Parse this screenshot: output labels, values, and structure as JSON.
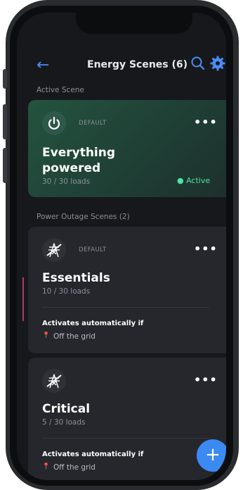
{
  "header": {
    "title": "Energy Scenes (6)",
    "back_icon": "arrow-left-icon",
    "search_icon": "search-icon",
    "settings_icon": "gear-icon"
  },
  "sections": {
    "active_label": "Active Scene",
    "outage_label": "Power Outage Scenes (2)"
  },
  "active_scene": {
    "tag": "DEFAULT",
    "name_line1": "Everything",
    "name_line2": "powered",
    "loads": "30 / 30 loads",
    "status": "● Active",
    "icon": "power-icon"
  },
  "outage_scenes": [
    {
      "tag": "DEFAULT",
      "name": "Essentials",
      "loads": "10 / 30 loads",
      "auto_label": "Activates automatically if",
      "condition": "Off the grid",
      "icon": "grid-off-icon"
    },
    {
      "tag": "",
      "name": "Critical",
      "loads": "5 / 30 loads",
      "auto_label": "Activates automatically if",
      "condition": "Off the grid",
      "icon": "grid-off-icon"
    }
  ],
  "colors": {
    "accent": "#3b8af2",
    "active_green": "#4ee3a3",
    "background": "#17181c",
    "card": "#25272d"
  },
  "fab": {
    "label": "+"
  },
  "more_label": "•••",
  "tab_label": "‹"
}
